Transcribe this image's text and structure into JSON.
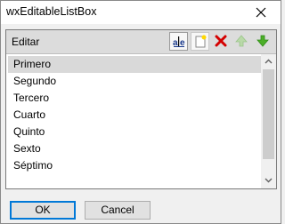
{
  "window": {
    "title": "wxEditableListBox"
  },
  "listbox": {
    "header_label": "Editar",
    "items": [
      "Primero",
      "Segundo",
      "Tercero",
      "Cuarto",
      "Quinto",
      "Sexto",
      "Séptimo"
    ],
    "selected_item": "Primero"
  },
  "toolbar": {
    "buttons": [
      "edit-item-icon",
      "new-item-icon",
      "delete-item-icon",
      "move-up-icon",
      "move-down-icon"
    ]
  },
  "buttons": {
    "ok_label": "OK",
    "cancel_label": "Cancel"
  },
  "colors": {
    "accent": "#0078d7",
    "selection": "#d9d9d9",
    "delete_red": "#d40000",
    "arrow_green": "#4caf28"
  }
}
